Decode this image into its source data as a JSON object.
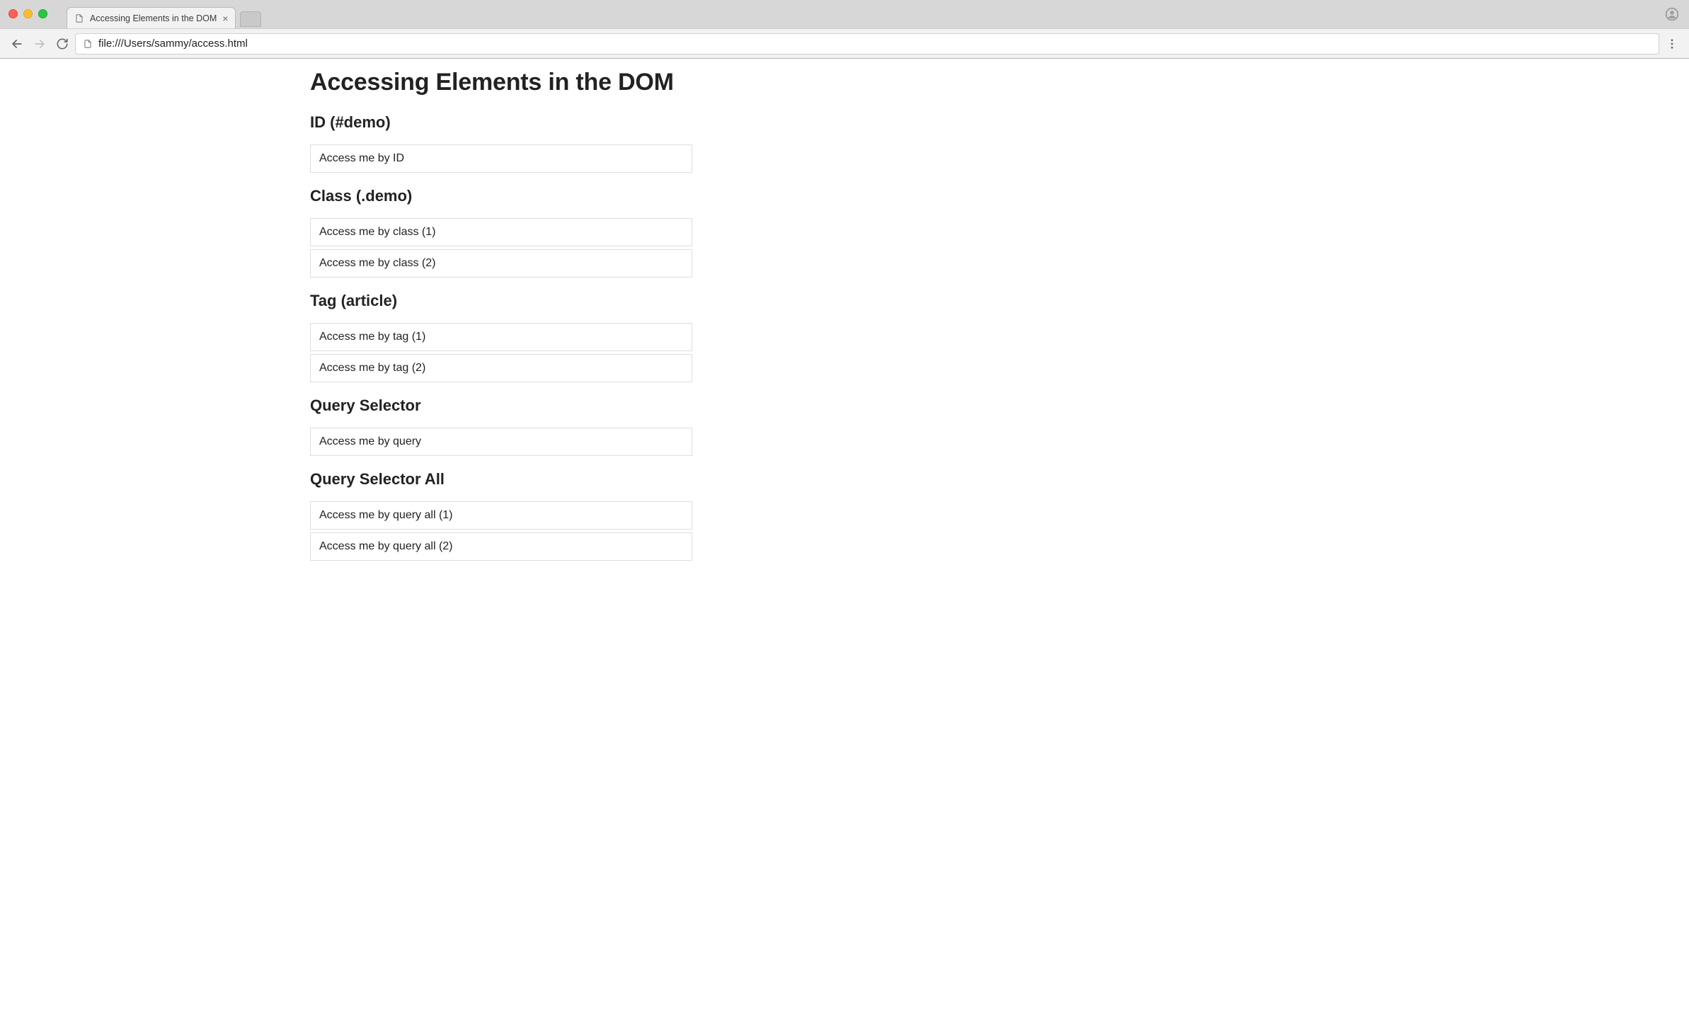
{
  "browser": {
    "tab_title": "Accessing Elements in the DOM",
    "url": "file:///Users/sammy/access.html"
  },
  "page": {
    "heading": "Accessing Elements in the DOM",
    "sections": [
      {
        "title": "ID (#demo)",
        "items": [
          "Access me by ID"
        ]
      },
      {
        "title": "Class (.demo)",
        "items": [
          "Access me by class (1)",
          "Access me by class (2)"
        ]
      },
      {
        "title": "Tag (article)",
        "items": [
          "Access me by tag (1)",
          "Access me by tag (2)"
        ]
      },
      {
        "title": "Query Selector",
        "items": [
          "Access me by query"
        ]
      },
      {
        "title": "Query Selector All",
        "items": [
          "Access me by query all (1)",
          "Access me by query all (2)"
        ]
      }
    ]
  }
}
